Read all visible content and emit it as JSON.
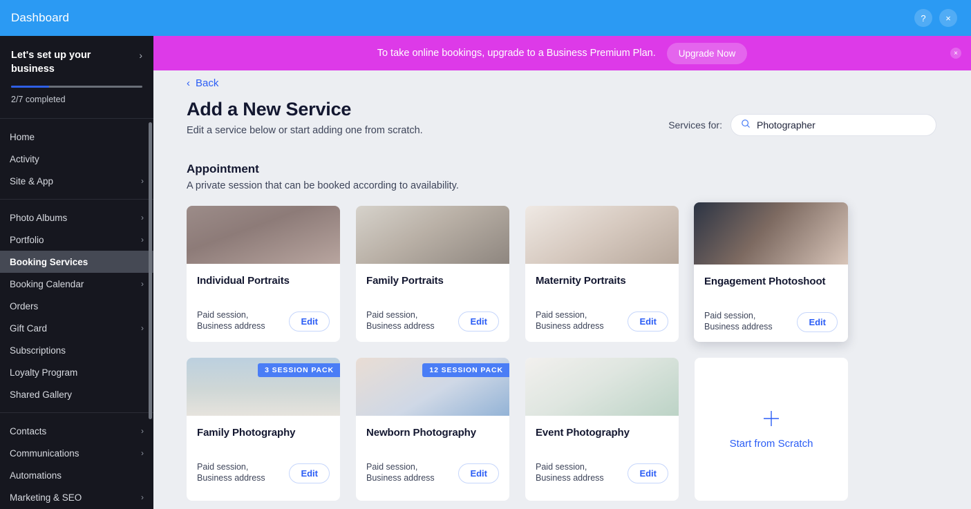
{
  "topbar": {
    "title": "Dashboard",
    "help_icon": "help-question-icon",
    "help_label": "?",
    "close_icon": "close-icon",
    "close_label": "×"
  },
  "sidebar": {
    "setup": {
      "title": "Let's set up your business",
      "chevron": "›",
      "progress_label": "2/7 completed",
      "progress_percent": 29
    },
    "groups": [
      {
        "items": [
          {
            "label": "Home",
            "chevron": "",
            "active": false
          },
          {
            "label": "Activity",
            "chevron": "",
            "active": false
          },
          {
            "label": "Site & App",
            "chevron": "›",
            "active": false
          }
        ]
      },
      {
        "items": [
          {
            "label": "Photo Albums",
            "chevron": "›",
            "active": false
          },
          {
            "label": "Portfolio",
            "chevron": "›",
            "active": false
          },
          {
            "label": "Booking Services",
            "chevron": "",
            "active": true
          },
          {
            "label": "Booking Calendar",
            "chevron": "›",
            "active": false
          },
          {
            "label": "Orders",
            "chevron": "",
            "active": false
          },
          {
            "label": "Gift Card",
            "chevron": "›",
            "active": false
          },
          {
            "label": "Subscriptions",
            "chevron": "",
            "active": false
          },
          {
            "label": "Loyalty Program",
            "chevron": "",
            "active": false
          },
          {
            "label": "Shared Gallery",
            "chevron": "",
            "active": false
          }
        ]
      },
      {
        "items": [
          {
            "label": "Contacts",
            "chevron": "›",
            "active": false
          },
          {
            "label": "Communications",
            "chevron": "›",
            "active": false
          },
          {
            "label": "Automations",
            "chevron": "",
            "active": false
          },
          {
            "label": "Marketing & SEO",
            "chevron": "›",
            "active": false
          }
        ]
      }
    ]
  },
  "promo": {
    "text": "To take online bookings, upgrade to a Business Premium Plan.",
    "button_label": "Upgrade Now",
    "close_icon": "close-icon",
    "close_label": "×",
    "background_color": "#dd3ae8"
  },
  "main": {
    "back_label": "Back",
    "back_chevron": "‹",
    "title": "Add a New Service",
    "subtitle": "Edit a service below or start adding one from scratch.",
    "services_for_label": "Services for:",
    "search": {
      "value": "Photographer",
      "placeholder": "Search",
      "icon": "search-icon"
    },
    "section": {
      "title": "Appointment",
      "subtitle": "A private session that can be booked according to availability."
    },
    "cards": [
      {
        "title": "Individual Portraits",
        "meta_line1": "Paid session,",
        "meta_line2": "Business address",
        "edit_label": "Edit",
        "badge": "",
        "photo": "ph1",
        "hover": false
      },
      {
        "title": "Family Portraits",
        "meta_line1": "Paid session,",
        "meta_line2": "Business address",
        "edit_label": "Edit",
        "badge": "",
        "photo": "ph2",
        "hover": false
      },
      {
        "title": "Maternity Portraits",
        "meta_line1": "Paid session,",
        "meta_line2": "Business address",
        "edit_label": "Edit",
        "badge": "",
        "photo": "ph3",
        "hover": false
      },
      {
        "title": "Engagement Photoshoot",
        "meta_line1": "Paid session,",
        "meta_line2": "Business address",
        "edit_label": "Edit",
        "badge": "",
        "photo": "ph4",
        "hover": true
      },
      {
        "title": "Family Photography",
        "meta_line1": "Paid session,",
        "meta_line2": "Business address",
        "edit_label": "Edit",
        "badge": "3 SESSION PACK",
        "photo": "ph5",
        "hover": false
      },
      {
        "title": "Newborn Photography",
        "meta_line1": "Paid session,",
        "meta_line2": "Business address",
        "edit_label": "Edit",
        "badge": "12 SESSION PACK",
        "photo": "ph6",
        "hover": false
      },
      {
        "title": "Event Photography",
        "meta_line1": "Paid session,",
        "meta_line2": "Business address",
        "edit_label": "Edit",
        "badge": "",
        "photo": "ph7",
        "hover": false
      }
    ],
    "scratch_card": {
      "label": "Start from Scratch",
      "icon": "plus-icon"
    }
  },
  "colors": {
    "topbar_blue": "#2b9af3",
    "accent_blue": "#2b5df5",
    "promo_magenta": "#dd3ae8",
    "sidebar_dark": "#16171f",
    "badge_blue": "#4a7df6"
  }
}
